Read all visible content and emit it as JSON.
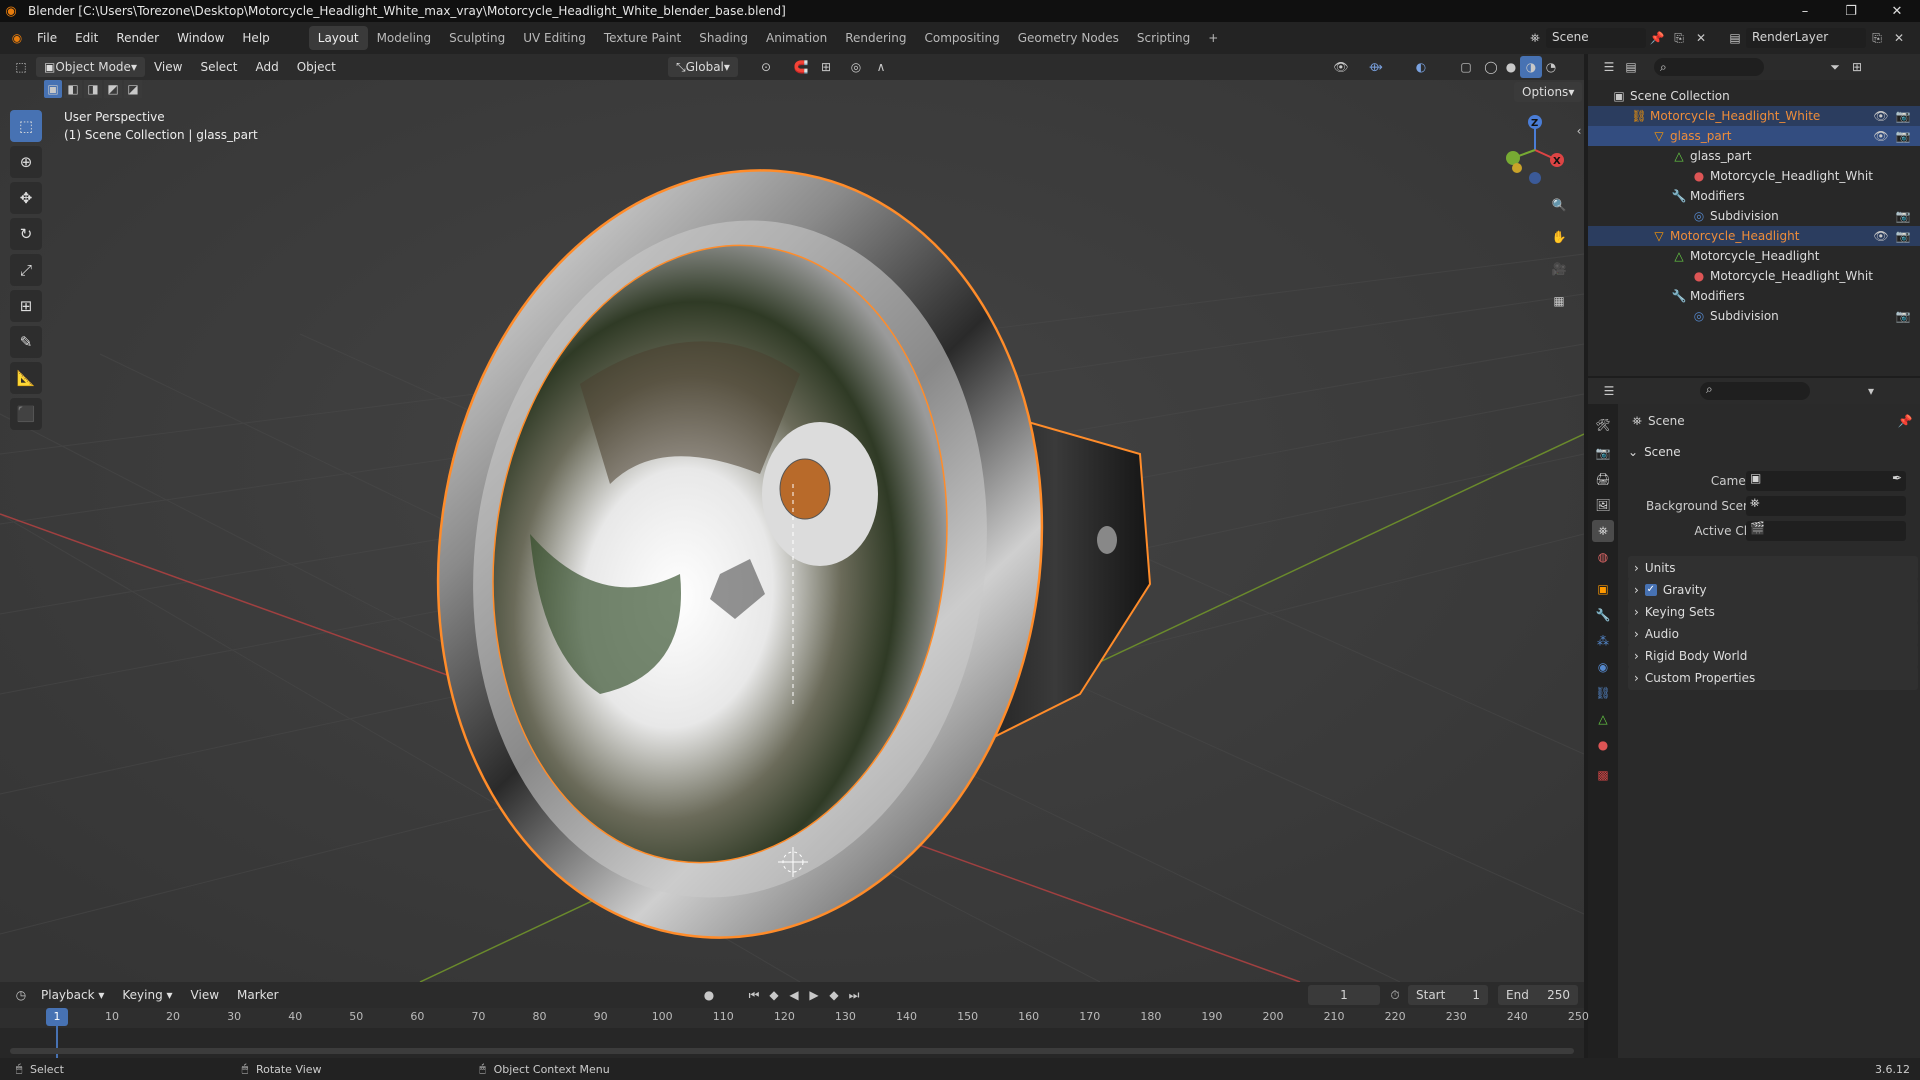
{
  "window": {
    "title": "Blender [C:\\Users\\Torezone\\Desktop\\Motorcycle_Headlight_White_max_vray\\Motorcycle_Headlight_White_blender_base.blend]"
  },
  "menu": [
    "File",
    "Edit",
    "Render",
    "Window",
    "Help"
  ],
  "workspaces": [
    "Layout",
    "Modeling",
    "Sculpting",
    "UV Editing",
    "Texture Paint",
    "Shading",
    "Animation",
    "Rendering",
    "Compositing",
    "Geometry Nodes",
    "Scripting"
  ],
  "active_workspace": "Layout",
  "topright": {
    "scene": "Scene",
    "view_layer": "RenderLayer"
  },
  "viewport_header": {
    "mode": "Object Mode",
    "menus": [
      "View",
      "Select",
      "Add",
      "Object"
    ],
    "orientation": "Global",
    "options": "Options"
  },
  "viewport": {
    "perspective": "User Perspective",
    "collection": "(1) Scene Collection | glass_part"
  },
  "outliner": {
    "root": "Scene Collection",
    "rows": [
      {
        "label": "Motorcycle_Headlight_White",
        "indent": 1
      },
      {
        "label": "glass_part",
        "indent": 2
      },
      {
        "label": "glass_part",
        "indent": 3
      },
      {
        "label": "Motorcycle_Headlight_Whit",
        "indent": 4
      },
      {
        "label": "Modifiers",
        "indent": 3
      },
      {
        "label": "Subdivision",
        "indent": 4
      },
      {
        "label": "Motorcycle_Headlight",
        "indent": 2
      },
      {
        "label": "Motorcycle_Headlight",
        "indent": 3
      },
      {
        "label": "Motorcycle_Headlight_Whit",
        "indent": 4
      },
      {
        "label": "Modifiers",
        "indent": 3
      },
      {
        "label": "Subdivision",
        "indent": 4
      }
    ]
  },
  "properties": {
    "context": "Scene",
    "panel": "Scene",
    "fields": [
      "Camera",
      "Background Scene",
      "Active Clip"
    ],
    "sections": [
      "Units",
      "Gravity",
      "Keying Sets",
      "Audio",
      "Rigid Body World",
      "Custom Properties"
    ]
  },
  "timeline": {
    "menus": [
      "Playback",
      "Keying",
      "View",
      "Marker"
    ],
    "current_frame": "1",
    "start_label": "Start",
    "start": "1",
    "end_label": "End",
    "end": "250",
    "ticks": [
      "1",
      "10",
      "20",
      "30",
      "40",
      "50",
      "60",
      "70",
      "80",
      "90",
      "100",
      "110",
      "120",
      "130",
      "140",
      "150",
      "160",
      "170",
      "180",
      "190",
      "200",
      "210",
      "220",
      "230",
      "240",
      "250"
    ]
  },
  "status": {
    "select": "Select",
    "rotate": "Rotate View",
    "context_menu": "Object Context Menu",
    "version": "3.6.12"
  },
  "colors": {
    "selection": "#ff8c2a",
    "accent": "#4772b3",
    "orange_text": "#ef8d3a",
    "x_axis": "#c24848",
    "y_axis": "#6a9b2c"
  }
}
